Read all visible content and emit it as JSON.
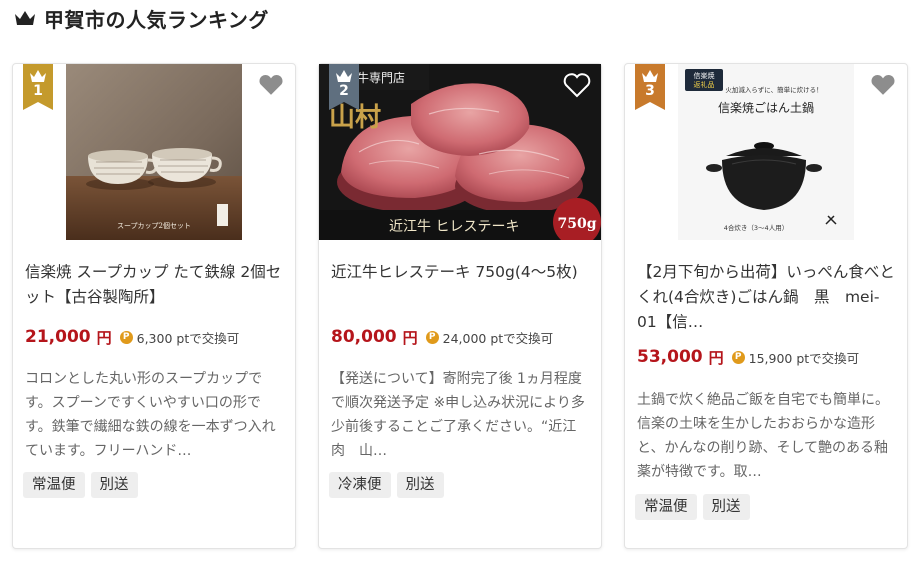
{
  "header": {
    "title": "甲賀市の人気ランキング"
  },
  "colors": {
    "price": "#b5151b",
    "gold": "#c49a2c",
    "slate": "#5f6f7f",
    "bronze": "#c87a2c",
    "point": "#e09a1b"
  },
  "cards": [
    {
      "rank": "1",
      "image_caption": "スープカップ2個セット",
      "title": "信楽焼 スープカップ たて鉄線 2個セット【古谷製陶所】",
      "price": "21,000",
      "yen": "円",
      "points": "6,300 ptで交換可",
      "description": "コロンとした丸い形のスープカップです。スプーンですくいやすい口の形です。鉄筆で繊細な鉄の線を一本ずつ入れています。フリーハンド…",
      "tags": [
        "常温便",
        "別送"
      ]
    },
    {
      "rank": "2",
      "image_shop": "近江牛専門店",
      "image_label": "近江牛 ヒレステーキ",
      "image_weight": "750g",
      "title": "近江牛ヒレステーキ 750g(4〜5枚)",
      "price": "80,000",
      "yen": "円",
      "points": "24,000 ptで交換可",
      "description": "【発送について】寄附完了後 1ヵ月程度で順次発送予定 ※申し込み状況により多少前後することご了承ください。“近江肉　山…",
      "tags": [
        "冷凍便",
        "別送"
      ]
    },
    {
      "rank": "3",
      "image_tag1": "信楽焼",
      "image_tag2": "返礼品",
      "image_top": "火加減入らずに、簡単に炊ける！",
      "image_title": "信楽焼ごはん土鍋",
      "image_caption": "4合炊き（3〜4人用）",
      "title": "【2月下旬から出荷】いっぺん食べとくれ(4合炊き)ごはん鍋　黒　mei-01【信…",
      "price": "53,000",
      "yen": "円",
      "points": "15,900 ptで交換可",
      "description": "土鍋で炊く絶品ご飯を自宅でも簡単に。信楽の土味を生かしたおおらかな造形と、かんなの削り跡、そして艶のある釉薬が特徴です。取…",
      "tags": [
        "常温便",
        "別送"
      ]
    }
  ]
}
